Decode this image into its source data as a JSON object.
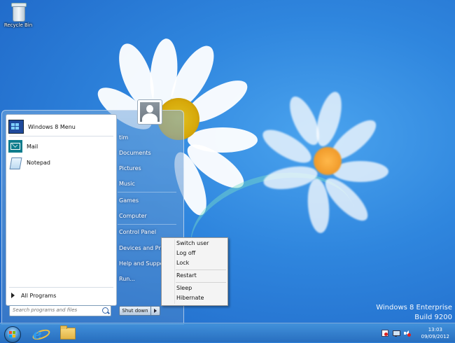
{
  "desktop": {
    "icons": [
      {
        "label": "Recycle Bin"
      }
    ],
    "watermark": {
      "line1": "Windows 8 Enterprise",
      "line2": "Build 9200"
    }
  },
  "start_menu": {
    "pinned": [
      {
        "label": "Windows 8 Menu",
        "icon": "windows8-menu-icon"
      },
      {
        "label": "Mail",
        "icon": "mail-icon"
      },
      {
        "label": "Notepad",
        "icon": "notepad-icon"
      }
    ],
    "all_programs_label": "All Programs",
    "search_placeholder": "Search programs and files",
    "right_items": [
      "tim",
      "Documents",
      "Pictures",
      "Music",
      "Games",
      "Computer",
      "Control Panel",
      "Devices and Print",
      "Help and Suppor",
      "Run..."
    ],
    "shutdown_label": "Shut down"
  },
  "power_menu": {
    "items": [
      "Switch user",
      "Log off",
      "Lock",
      "Restart",
      "Sleep",
      "Hibernate"
    ]
  },
  "taskbar": {
    "pinned": [
      "internet-explorer-icon",
      "file-explorer-icon"
    ],
    "clock": {
      "time": "13:03",
      "date": "09/09/2012"
    }
  },
  "colors": {
    "desktop_blue": "#2f86de",
    "taskbar_blue": "#2e73c2",
    "menu_bg": "#f4f4f4"
  }
}
